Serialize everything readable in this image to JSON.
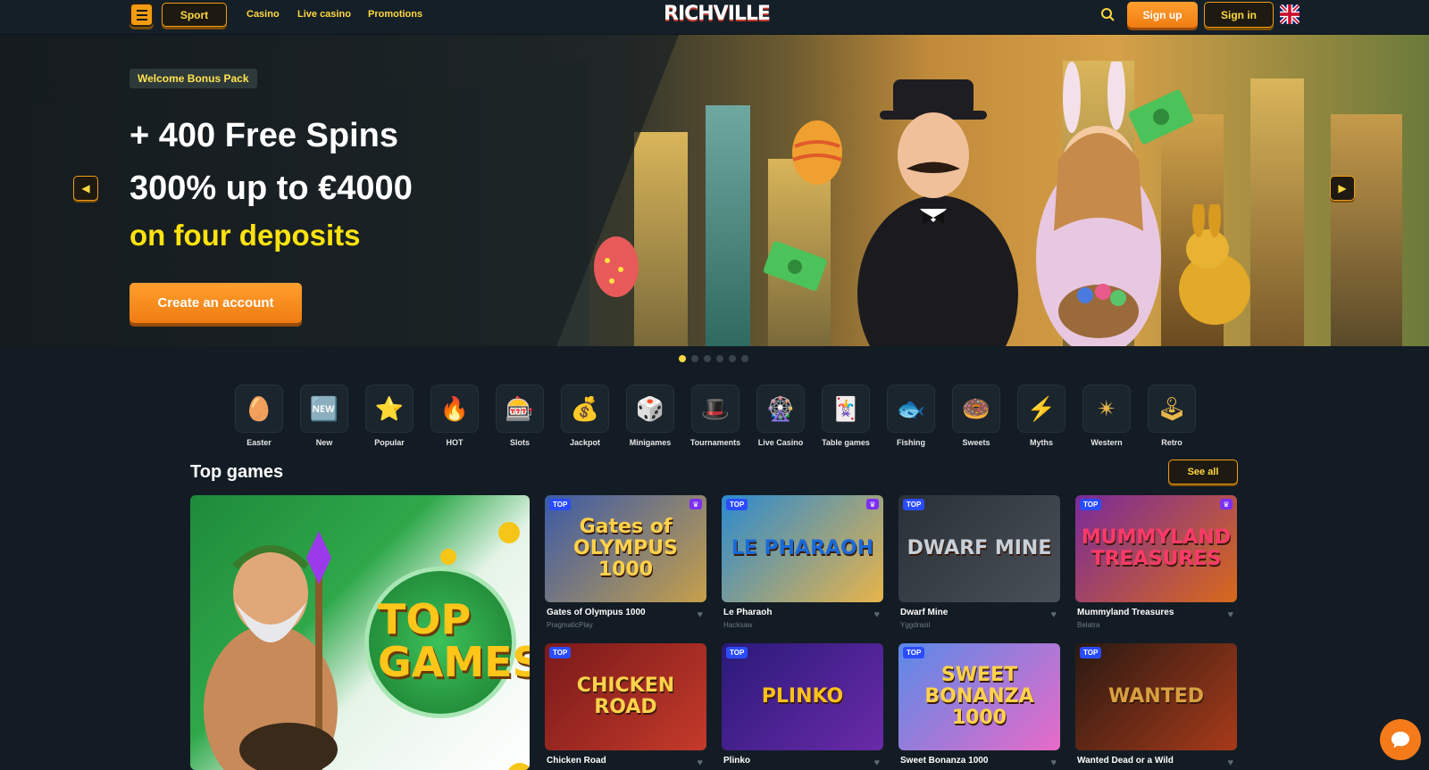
{
  "header": {
    "sport_label": "Sport",
    "nav": [
      "Casino",
      "Live casino",
      "Promotions"
    ],
    "logo_text": "RICHVILLE",
    "signup_label": "Sign up",
    "signin_label": "Sign in",
    "language_icon": "uk-flag-icon",
    "accent_color": "#f39c12"
  },
  "hero": {
    "badge": "Welcome Bonus Pack",
    "line1": "+ 400 Free Spins",
    "line2": "300% up to €4000",
    "line3": "on four deposits",
    "cta_label": "Create an account",
    "slides_total": 6,
    "slide_active": 1
  },
  "categories": [
    {
      "label": "Easter",
      "icon": "🥚"
    },
    {
      "label": "New",
      "icon": "🆕"
    },
    {
      "label": "Popular",
      "icon": "⭐"
    },
    {
      "label": "HOT",
      "icon": "🔥"
    },
    {
      "label": "Slots",
      "icon": "🎰"
    },
    {
      "label": "Jackpot",
      "icon": "💰"
    },
    {
      "label": "Minigames",
      "icon": "🎲"
    },
    {
      "label": "Tournaments",
      "icon": "🎩"
    },
    {
      "label": "Live Casino",
      "icon": "🎡"
    },
    {
      "label": "Table games",
      "icon": "🃏"
    },
    {
      "label": "Fishing",
      "icon": "🐟"
    },
    {
      "label": "Sweets",
      "icon": "🍩"
    },
    {
      "label": "Myths",
      "icon": "⚡"
    },
    {
      "label": "Western",
      "icon": "✴"
    },
    {
      "label": "Retro",
      "icon": "🕹"
    }
  ],
  "top_games": {
    "title": "Top games",
    "see_all_label": "See all",
    "promo_text": "TOP GAMES",
    "top_tag": "TOP",
    "games": [
      {
        "name": "Gates of Olympus 1000",
        "provider": "PragmaticPlay",
        "thumb": "Gates of OLYMPUS 1000"
      },
      {
        "name": "Le Pharaoh",
        "provider": "Hacksaw",
        "thumb": "LE PHARAOH"
      },
      {
        "name": "Dwarf Mine",
        "provider": "Yggdrasil",
        "thumb": "DWARF MINE"
      },
      {
        "name": "Mummyland Treasures",
        "provider": "Belatra",
        "thumb": "MUMMYLAND TREASURES"
      },
      {
        "name": "Chicken Road",
        "provider": "",
        "thumb": "CHICKEN ROAD"
      },
      {
        "name": "Plinko",
        "provider": "",
        "thumb": "PLINKO"
      },
      {
        "name": "Sweet Bonanza 1000",
        "provider": "",
        "thumb": "SWEET BONANZA 1000"
      },
      {
        "name": "Wanted Dead or a Wild",
        "provider": "",
        "thumb": "WANTED"
      }
    ]
  }
}
